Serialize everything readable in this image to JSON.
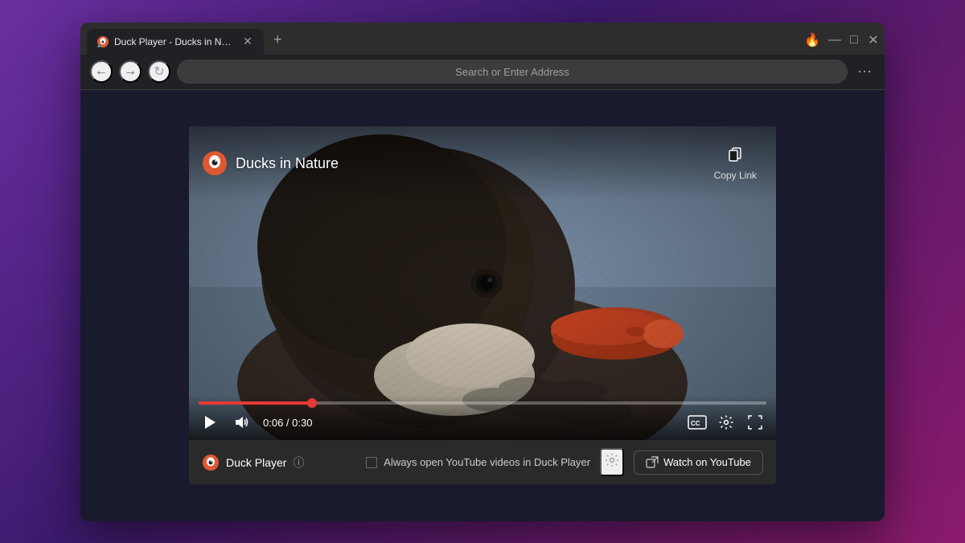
{
  "browser": {
    "tab": {
      "title": "Duck Player - Ducks in Nature...",
      "favicon": "🦆"
    },
    "new_tab_label": "+",
    "address_bar": {
      "placeholder": "Search or Enter Address",
      "value": "Search or Enter Address"
    },
    "controls": {
      "minimize": "—",
      "maximize": "□",
      "close": "✕"
    },
    "menu_dots": "⋯",
    "back_btn": "←",
    "forward_btn": "→",
    "refresh_btn": "↻"
  },
  "duck_player": {
    "title": "Ducks in Nature",
    "copy_link_label": "Copy Link",
    "time_current": "0:06",
    "time_total": "0:30",
    "time_display": "0:06 / 0:30",
    "progress_percent": 20,
    "player_name": "Duck Player",
    "always_open_label": "Always open YouTube videos in Duck Player",
    "watch_youtube_label": "Watch on YouTube",
    "settings_icon": "⚙",
    "info_icon": "ⓘ"
  }
}
